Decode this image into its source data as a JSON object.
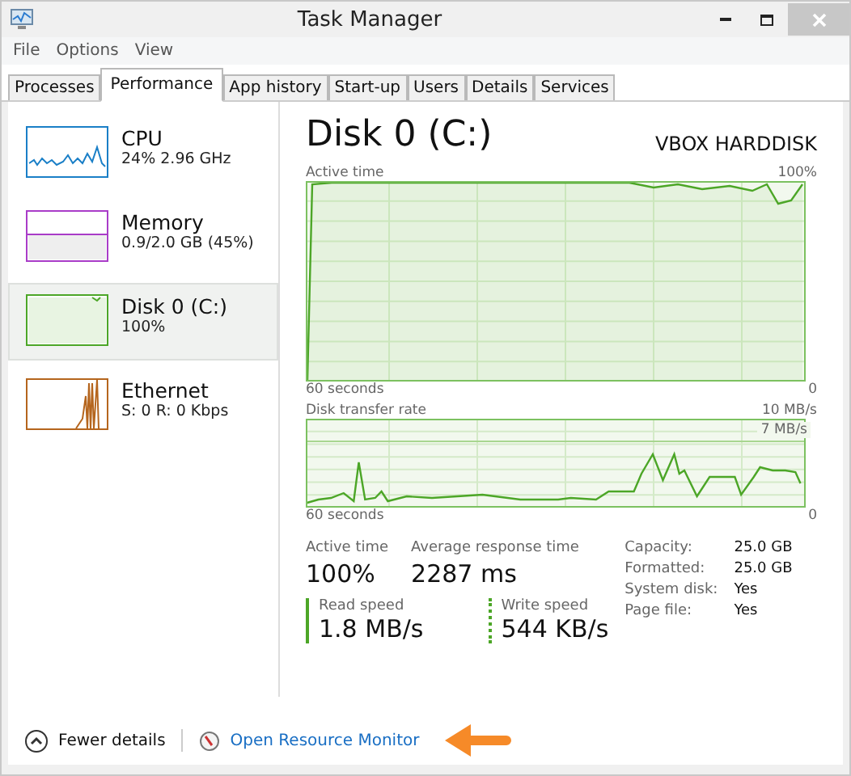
{
  "window": {
    "title": "Task Manager"
  },
  "menu": [
    "File",
    "Options",
    "View"
  ],
  "tabs": [
    {
      "label": "Processes",
      "selected": false
    },
    {
      "label": "Performance",
      "selected": true
    },
    {
      "label": "App history",
      "selected": false
    },
    {
      "label": "Start-up",
      "selected": false
    },
    {
      "label": "Users",
      "selected": false
    },
    {
      "label": "Details",
      "selected": false
    },
    {
      "label": "Services",
      "selected": false
    }
  ],
  "sidebar": {
    "items": [
      {
        "kind": "line",
        "name": "CPU",
        "detail": "24%  2.96 GHz",
        "color": "#1a7fc7",
        "selected": false
      },
      {
        "kind": "bar",
        "name": "Memory",
        "detail": "0.9/2.0 GB (45%)",
        "color": "#a93cc8",
        "selected": false
      },
      {
        "kind": "fill",
        "name": "Disk 0 (C:)",
        "detail": "100%",
        "color": "#4ca627",
        "selected": true
      },
      {
        "kind": "spikes",
        "name": "Ethernet",
        "detail": "S: 0 R: 0 Kbps",
        "color": "#b5651d",
        "selected": false
      }
    ]
  },
  "detail": {
    "title": "Disk 0 (C:)",
    "model": "VBOX HARDDISK",
    "active_graph": {
      "label": "Active time",
      "max": "100%",
      "time": "60 seconds",
      "min": "0"
    },
    "transfer_graph": {
      "label": "Disk transfer rate",
      "max": "10 MB/s",
      "marker": "7 MB/s",
      "time": "60 seconds",
      "min": "0"
    },
    "stats": [
      {
        "label": "Active time",
        "value": "100%"
      },
      {
        "label": "Average response time",
        "value": "2287 ms"
      }
    ],
    "speeds": [
      {
        "kind": "solid",
        "label": "Read speed",
        "value": "1.8 MB/s"
      },
      {
        "kind": "dotted",
        "label": "Write speed",
        "value": "544 KB/s"
      }
    ],
    "properties": [
      {
        "label": "Capacity:",
        "value": "25.0 GB"
      },
      {
        "label": "Formatted:",
        "value": "25.0 GB"
      },
      {
        "label": "System disk:",
        "value": "Yes"
      },
      {
        "label": "Page file:",
        "value": "Yes"
      }
    ]
  },
  "footer": {
    "fewer": "Fewer details",
    "link": "Open Resource Monitor"
  }
}
